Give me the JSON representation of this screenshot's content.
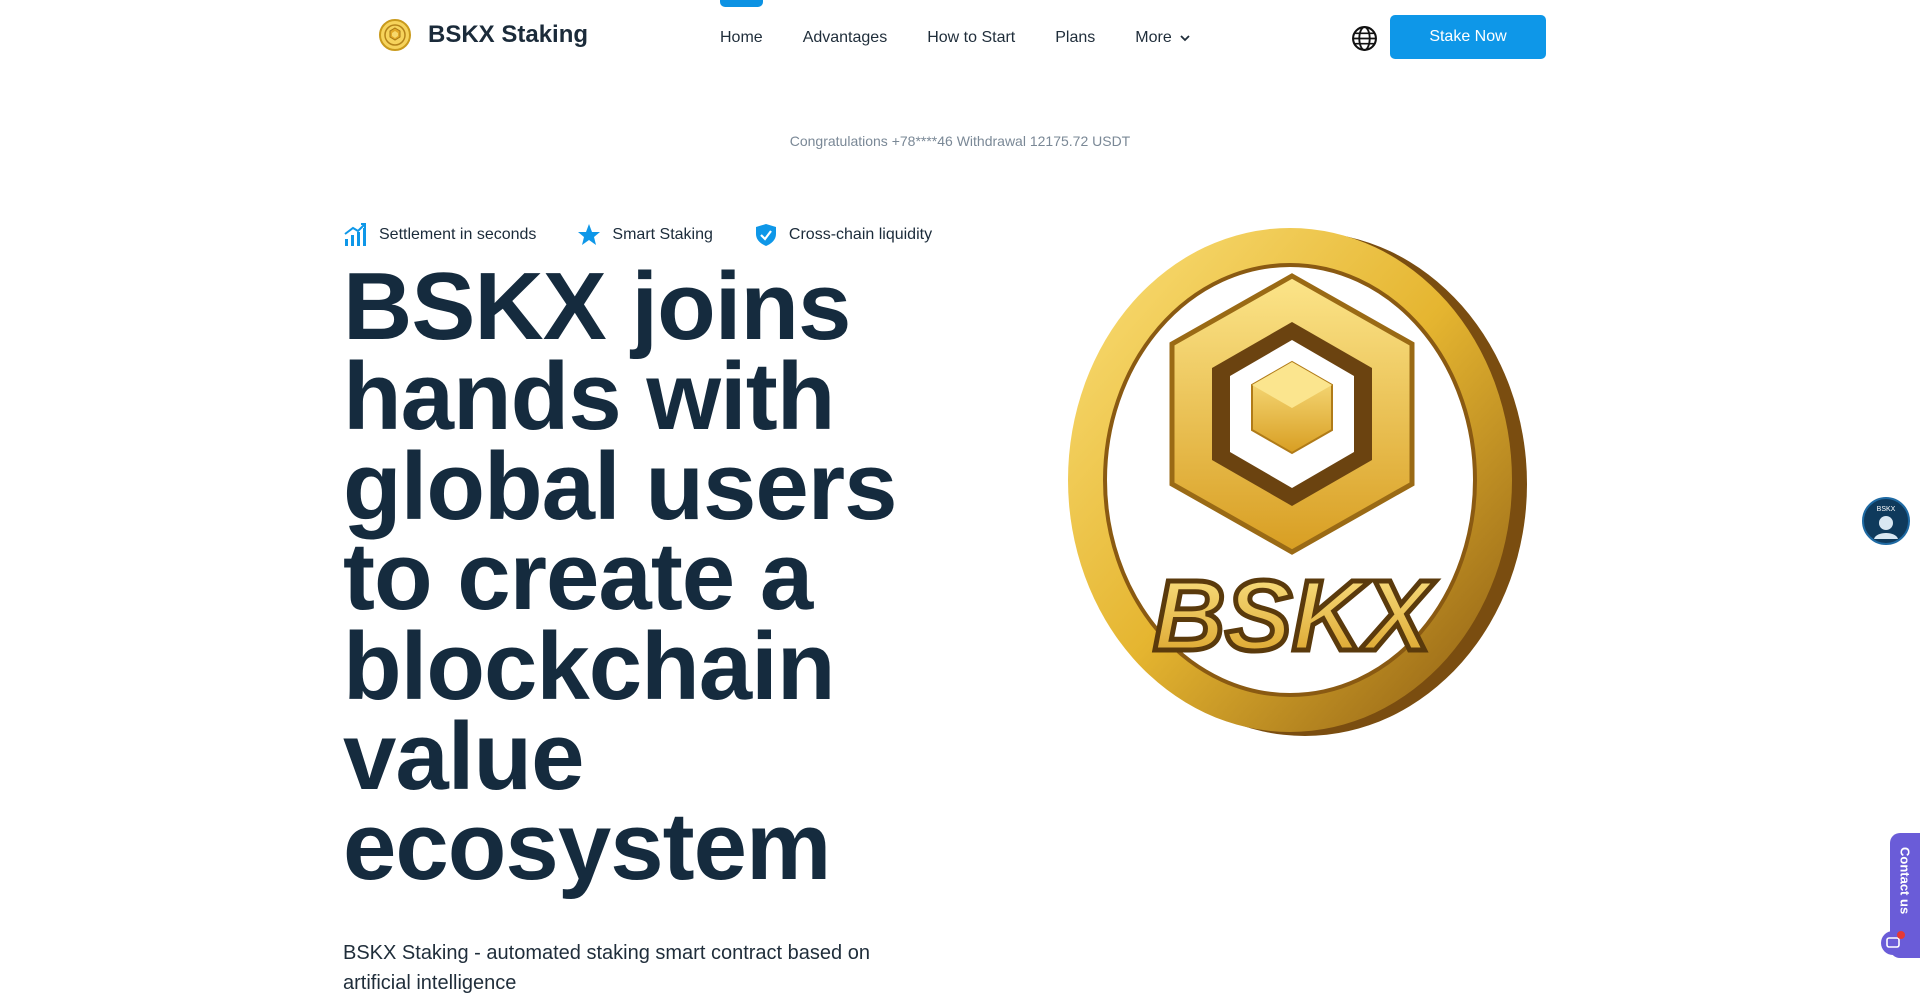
{
  "brand": {
    "name": "BSKX Staking",
    "logo_icon": "bskx-coin-logo"
  },
  "nav": {
    "items": [
      {
        "label": "Home",
        "active": true
      },
      {
        "label": "Advantages",
        "active": false
      },
      {
        "label": "How to Start",
        "active": false
      },
      {
        "label": "Plans",
        "active": false
      },
      {
        "label": "More",
        "active": false,
        "has_dropdown": true
      }
    ],
    "language_icon": "globe-icon",
    "cta_label": "Stake Now"
  },
  "ticker": {
    "text": "Congratulations +78****46 Withdrawal 12175.72 USDT"
  },
  "features": [
    {
      "icon": "bar-chart-icon",
      "label": "Settlement in seconds"
    },
    {
      "icon": "star-icon",
      "label": "Smart Staking"
    },
    {
      "icon": "shield-check-icon",
      "label": "Cross-chain liquidity"
    }
  ],
  "hero": {
    "headline": "BSKX joins hands with global users to create a blockchain value ecosystem",
    "subtitle": "BSKX Staking - automated staking smart contract based on artificial intelligence",
    "coin_text": "BSKX"
  },
  "floating": {
    "avatar_text": "BSKX",
    "contact_label": "Contact us",
    "chat_icon": "chat-bubble-icon"
  },
  "colors": {
    "accent": "#0e97e8",
    "heading": "#152b3e",
    "gold": "#e5b530",
    "contact_tab": "#6a5cd8"
  }
}
